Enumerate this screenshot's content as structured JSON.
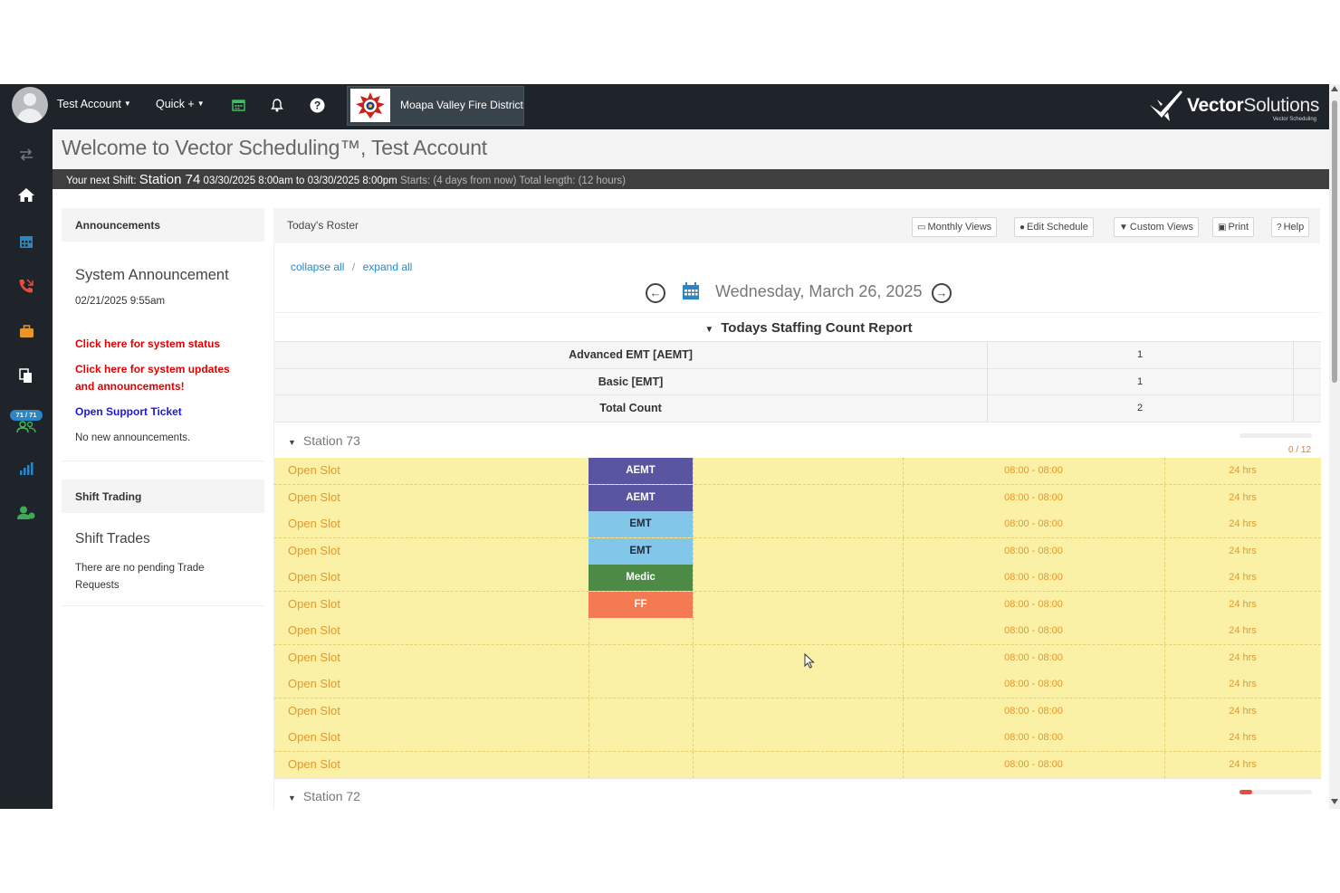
{
  "topbar": {
    "account_label": "Test Account",
    "quick_label": "Quick +",
    "org_name": "Moapa Valley Fire District",
    "brand_bold": "Vector",
    "brand_light": "Solutions",
    "brand_sub": "Vector Scheduling"
  },
  "sidebar": {
    "badge": "71 / 71",
    "items": [
      "swap-icon",
      "home-icon",
      "calendar-icon",
      "phone-icon",
      "briefcase-icon",
      "documents-icon",
      "users-icon",
      "chart-icon",
      "user-plus-icon"
    ]
  },
  "header": {
    "welcome": "Welcome to Vector Scheduling™, Test Account",
    "next_shift_prefix": "Your next Shift:",
    "next_shift_station": "Station 74",
    "next_shift_time": "03/30/2025 8:00am to 03/30/2025 8:00pm",
    "next_shift_meta": "Starts: (4 days from now) Total length: (12 hours)"
  },
  "announcements": {
    "heading": "Announcements",
    "title": "System Announcement",
    "date": "02/21/2025 9:55am",
    "link_status": "Click here for system status",
    "link_updates": "Click here for system updates and announcements!",
    "link_ticket": "Open Support Ticket",
    "empty": "No new announcements."
  },
  "shift_trading": {
    "heading": "Shift Trading",
    "title": "Shift Trades",
    "empty": "There are no pending Trade Requests"
  },
  "roster": {
    "title": "Today's Roster",
    "buttons": {
      "monthly": "Monthly Views",
      "edit": "Edit Schedule",
      "custom": "Custom Views",
      "print": "Print",
      "help": "Help"
    },
    "collapse": "collapse all",
    "separator": "/",
    "expand": "expand all",
    "date": "Wednesday, March 26, 2025",
    "staffing_title": "Todays Staffing Count Report",
    "staffing": [
      {
        "label": "Advanced EMT [AEMT]",
        "count": "1"
      },
      {
        "label": "Basic [EMT]",
        "count": "1"
      },
      {
        "label": "Total Count",
        "count": "2"
      }
    ],
    "station73": {
      "name": "Station 73",
      "count": "0 / 12",
      "progress": 0.0,
      "slots": [
        {
          "name": "Open Slot",
          "cred": "AEMT",
          "color": "#5a55a0",
          "time": "08:00 - 08:00",
          "hours": "24 hrs"
        },
        {
          "name": "Open Slot",
          "cred": "AEMT",
          "color": "#5a55a0",
          "time": "08:00 - 08:00",
          "hours": "24 hrs"
        },
        {
          "name": "Open Slot",
          "cred": "EMT",
          "color": "#82c6ea",
          "time": "08:00 - 08:00",
          "hours": "24 hrs"
        },
        {
          "name": "Open Slot",
          "cred": "EMT",
          "color": "#82c6ea",
          "time": "08:00 - 08:00",
          "hours": "24 hrs"
        },
        {
          "name": "Open Slot",
          "cred": "Medic",
          "color": "#4d8a45",
          "time": "08:00 - 08:00",
          "hours": "24 hrs"
        },
        {
          "name": "Open Slot",
          "cred": "FF",
          "color": "#f47a53",
          "time": "08:00 - 08:00",
          "hours": "24 hrs"
        },
        {
          "name": "Open Slot",
          "cred": "",
          "color": "",
          "time": "08:00 - 08:00",
          "hours": "24 hrs"
        },
        {
          "name": "Open Slot",
          "cred": "",
          "color": "",
          "time": "08:00 - 08:00",
          "hours": "24 hrs"
        },
        {
          "name": "Open Slot",
          "cred": "",
          "color": "",
          "time": "08:00 - 08:00",
          "hours": "24 hrs"
        },
        {
          "name": "Open Slot",
          "cred": "",
          "color": "",
          "time": "08:00 - 08:00",
          "hours": "24 hrs"
        },
        {
          "name": "Open Slot",
          "cred": "",
          "color": "",
          "time": "08:00 - 08:00",
          "hours": "24 hrs"
        },
        {
          "name": "Open Slot",
          "cred": "",
          "color": "",
          "time": "08:00 - 08:00",
          "hours": "24 hrs"
        }
      ]
    },
    "station72": {
      "name": "Station 72",
      "progress": 0.17
    }
  },
  "colors": {
    "accent": "#2a88c8",
    "slot_bg": "#faf0a6",
    "slot_text": "#e7982a",
    "dark": "#1e2429",
    "alert_red": "#e00000",
    "link_blue": "#1a1ad6"
  }
}
